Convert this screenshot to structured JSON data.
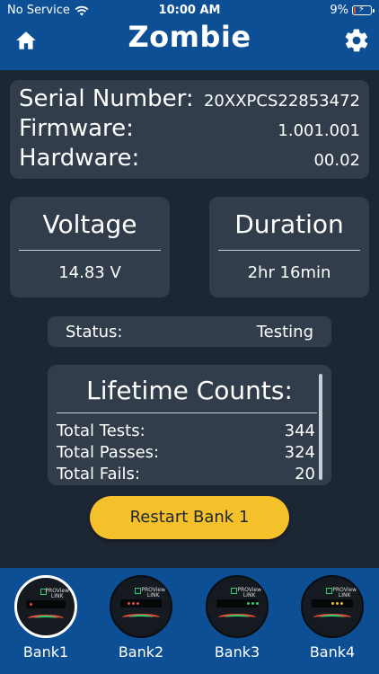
{
  "status_bar": {
    "carrier": "No Service",
    "time": "10:00 AM",
    "battery": "9%"
  },
  "header": {
    "title": "Zombie",
    "home_icon": "home-icon",
    "settings_icon": "gear-icon"
  },
  "info": {
    "serial_label": "Serial Number:",
    "serial_value": "20XXPCS22853472",
    "firmware_label": "Firmware:",
    "firmware_value": "1.001.001",
    "hardware_label": "Hardware:",
    "hardware_value": "00.02"
  },
  "voltage": {
    "title": "Voltage",
    "value": "14.83 V"
  },
  "duration": {
    "title": "Duration",
    "value": "2hr 16min"
  },
  "status": {
    "label": "Status:",
    "value": "Testing"
  },
  "lifetime": {
    "title": "Lifetime Counts:",
    "rows": [
      {
        "label": "Total Tests:",
        "value": "344"
      },
      {
        "label": "Total Passes:",
        "value": "324"
      },
      {
        "label": "Total Fails:",
        "value": "20"
      }
    ]
  },
  "restart_button": {
    "label": "Restart Bank 1",
    "color": "#f4c12a"
  },
  "banks": [
    {
      "label": "Bank1",
      "active": true,
      "led_color": "#e74c3c",
      "led_count": 1
    },
    {
      "label": "Bank2",
      "active": false,
      "led_color": "#e74c3c",
      "led_count": 3
    },
    {
      "label": "Bank3",
      "active": false,
      "led_color": "#2ecc71",
      "led_count": 3
    },
    {
      "label": "Bank4",
      "active": false,
      "led_color": "#f4c12a",
      "led_count": 3
    }
  ],
  "colors": {
    "header_blue": "#0d4f94",
    "background": "#1d2633",
    "card": "#323d4b"
  }
}
